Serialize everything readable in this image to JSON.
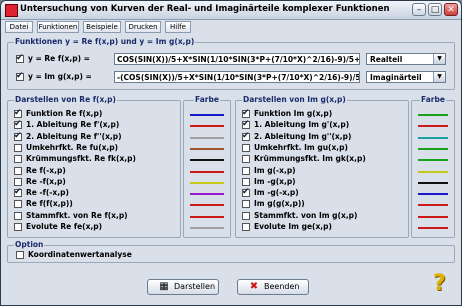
{
  "window": {
    "title": "Untersuchung von Kurven der Real- und Imaginärteile komplexer Funktionen"
  },
  "menu": [
    "Datei",
    "Funktionen",
    "Beispiele",
    "Drucken",
    "Hilfe"
  ],
  "functions": {
    "label": "Funktionen y = Re f(x,p) und y = Im g(x,p)",
    "re": {
      "label": "y = Re f(x,p) =",
      "expr": "COS(SIN(X))/5+X*SIN(1/10*SIN(3*P+(7/10*X)^2/16)-9)/5+1",
      "select": "Realteil",
      "checked": true
    },
    "im": {
      "label": "y = Im g(x,p) =",
      "expr": "-(COS(SIN(X))/5+X*SIN(1/10*SIN(3*P+(7/10*X)^2/16)-9)/5+1)*I",
      "select": "Imaginärteil",
      "checked": true
    }
  },
  "re_panel": {
    "label": "Darstellen von Re f(x,p)",
    "color_label": "Farbe",
    "items": [
      {
        "label": "Funktion Re f(x,p)",
        "checked": true,
        "color": "#1a1acc"
      },
      {
        "label": "1. Ableitung Re f'(x,p)",
        "checked": true,
        "color": "#cc1a1a"
      },
      {
        "label": "2. Ableitung Re f''(x,p)",
        "checked": true,
        "color": "#a0a0a0"
      },
      {
        "label": "Umkehrfkt. Re fu(x,p)",
        "checked": false,
        "color": "#a0522d"
      },
      {
        "label": "Krümmungsfkt. Re fk(x,p)",
        "checked": false,
        "color": "#111111"
      },
      {
        "label": "Re f(-x,p)",
        "checked": false,
        "color": "#cc1a1a"
      },
      {
        "label": "Re -f(x,p)",
        "checked": false,
        "color": "#c8c81a"
      },
      {
        "label": "Re -f(-x,p)",
        "checked": true,
        "color": "#9a1acc"
      },
      {
        "label": "Re f(f(x,p))",
        "checked": false,
        "color": "#cc1a1a"
      },
      {
        "label": "Stammfkt. von Re f(x,p)",
        "checked": false,
        "color": "#cc1a1a"
      },
      {
        "label": "Evolute Re fe(x,p)",
        "checked": false,
        "color": "#a0a0a0"
      }
    ]
  },
  "im_panel": {
    "label": "Darstellen von Im g(x,p)",
    "color_label": "Farbe",
    "items": [
      {
        "label": "Funktion Im g(x,p)",
        "checked": true,
        "color": "#1aa01a"
      },
      {
        "label": "1. Ableitung Im g'(x,p)",
        "checked": true,
        "color": "#cc1a1a"
      },
      {
        "label": "2. Ableitung Im g''(x,p)",
        "checked": true,
        "color": "#1aa0a0"
      },
      {
        "label": "Umkehrfkt. Im gu(x,p)",
        "checked": false,
        "color": "#1aa01a"
      },
      {
        "label": "Krümmungsfkt. Im gk(x,p)",
        "checked": false,
        "color": "#1aa01a"
      },
      {
        "label": "Im g(-x,p)",
        "checked": false,
        "color": "#c8c81a"
      },
      {
        "label": "Im -g(x,p)",
        "checked": false,
        "color": "#111111"
      },
      {
        "label": "Im -g(-x,p)",
        "checked": true,
        "color": "#1a1acc"
      },
      {
        "label": "Im g(g(x,p))",
        "checked": false,
        "color": "#cc1a1a"
      },
      {
        "label": "Stammfkt. von Im g(x,p)",
        "checked": false,
        "color": "#cc1a1a"
      },
      {
        "label": "Evolute Im ge(x,p)",
        "checked": false,
        "color": "#cc1a1a"
      }
    ]
  },
  "option": {
    "label": "Option",
    "item": "Koordinatenwertanalyse",
    "checked": false
  },
  "buttons": {
    "draw": "Darstellen",
    "quit": "Beenden"
  },
  "help": {
    "label": "?"
  }
}
